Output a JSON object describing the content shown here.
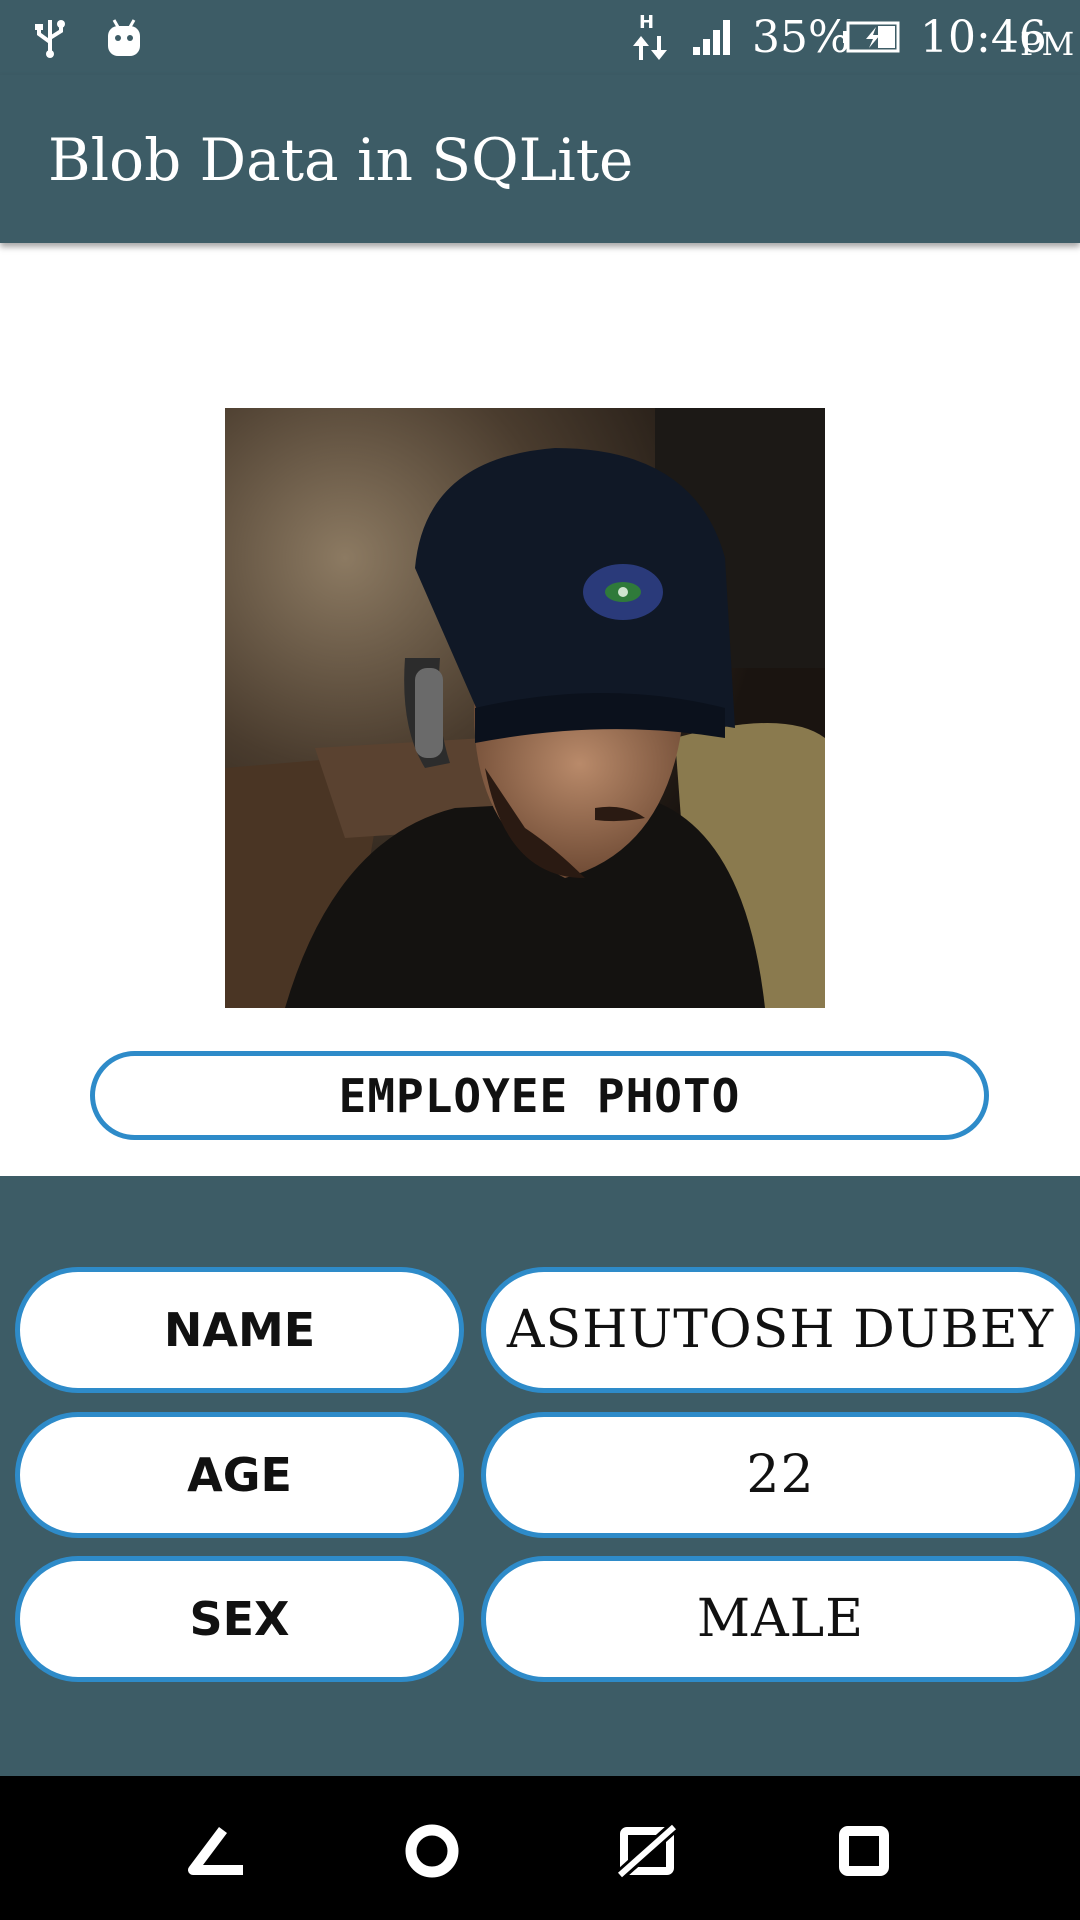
{
  "status_bar": {
    "icons": [
      "usb-icon",
      "android-debug-icon",
      "hspa-data-icon",
      "signal-icon",
      "battery-charging-icon"
    ],
    "battery_percent": "35%",
    "time": "10:46",
    "ampm": "PM"
  },
  "app_bar": {
    "title": "Blob Data in SQLite"
  },
  "photo": {
    "label": "EMPLOYEE PHOTO"
  },
  "fields": {
    "name": {
      "label": "NAME",
      "value": "ASHUTOSH DUBEY"
    },
    "age": {
      "label": "AGE",
      "value": "22"
    },
    "sex": {
      "label": "SEX",
      "value": "MALE"
    }
  },
  "nav_bar": {
    "icons": [
      "back-icon",
      "home-icon",
      "screenshot-off-icon",
      "recents-icon"
    ]
  },
  "colors": {
    "bar_bg": "#3d5c66",
    "pill_border": "#2e8bc9",
    "nav_bg": "#000000"
  }
}
